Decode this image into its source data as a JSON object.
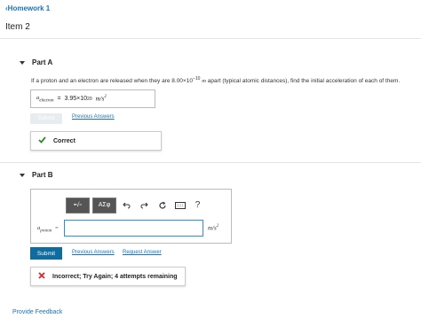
{
  "nav": {
    "back_label": "Homework 1"
  },
  "item": {
    "title": "Item 2"
  },
  "part_a": {
    "heading": "Part A",
    "question_pre": "If a proton and an electron are released when they are 8.00×10",
    "question_exp": "−10",
    "question_unit": "m",
    "question_post": "apart (typical atomic distances), find the initial acceleration of each of them.",
    "answer_label": "a",
    "answer_sub": "electron",
    "answer_eq": "=",
    "answer_mantissa": "3.95×10",
    "answer_exp": "20",
    "answer_unit": "m/s",
    "answer_unit_exp": "2",
    "submit_label": "Submit",
    "previous_answers_label": "Previous Answers",
    "feedback_text": "Correct"
  },
  "part_b": {
    "heading": "Part B",
    "toolbar": {
      "templates_label": "▪√▫",
      "symbols_label": "ΑΣφ",
      "help_label": "?"
    },
    "var_label": "a",
    "var_sub": "proton",
    "var_eq": "=",
    "input_value": "",
    "unit": "m/s",
    "unit_exp": "2",
    "submit_label": "Submit",
    "previous_answers_label": "Previous Answers",
    "request_answer_label": "Request Answer",
    "feedback_text": "Incorrect; Try Again; 4 attempts remaining"
  },
  "footer": {
    "provide_feedback_label": "Provide Feedback"
  },
  "colors": {
    "link": "#1a73b8",
    "submit": "#0f6c9e",
    "correct": "#2e8b2e",
    "incorrect": "#d62828",
    "input_focus": "#2e8fd6"
  },
  "icons": {
    "back": "chevron-left-icon",
    "collapse": "triangle-down-icon",
    "correct": "checkmark-icon",
    "incorrect": "x-icon",
    "undo": "undo-icon",
    "redo": "redo-icon",
    "reset": "reset-icon",
    "keyboard": "keyboard-icon"
  }
}
